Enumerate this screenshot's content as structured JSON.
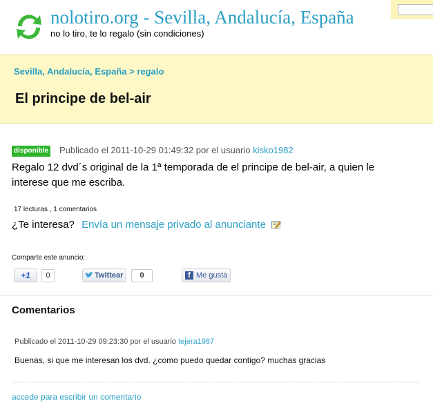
{
  "header": {
    "site_title": "nolotiro.org - Sevilla, Andalucía, España",
    "tagline": "no lo tiro, te lo regalo (sin condiciones)"
  },
  "breadcrumb": {
    "location": "Sevilla, Andalucía, España",
    "separator": ">",
    "section": "regalo"
  },
  "listing": {
    "title": "El principe de bel-air",
    "status": "disponible",
    "published_prefix": "Publicado el 2011-10-29 01:49:32 por el usuario",
    "user": "kisko1982",
    "description": "Regalo 12 dvd´s original de la 1ª temporada de el principe de bel-air, a quien le interese que me escriba.",
    "stats": "17 lecturas , 1 comentarios",
    "interest_question": "¿Te interesa?",
    "message_link": "Envía un mensaje privado al anunciante"
  },
  "share": {
    "label": "Comparte este anuncio:",
    "gplus_label": "+1",
    "gplus_count": "0",
    "twitter_label": "Twittear",
    "twitter_count": "0",
    "facebook_label": "Me gusta"
  },
  "comments": {
    "heading": "Comentarios",
    "items": [
      {
        "meta_prefix": "Publicado el 2011-10-29 09:23:30 por el usuario",
        "user": "tejera1987",
        "text": "Buenas, si que me interesan los dvd. ¿como puedo quedar contigo? muchas gracias"
      }
    ],
    "login_link": "accede para escribir un comentario"
  },
  "colors": {
    "link": "#2a9fc4",
    "banner": "#fdf8c6",
    "status": "#2db32d"
  }
}
